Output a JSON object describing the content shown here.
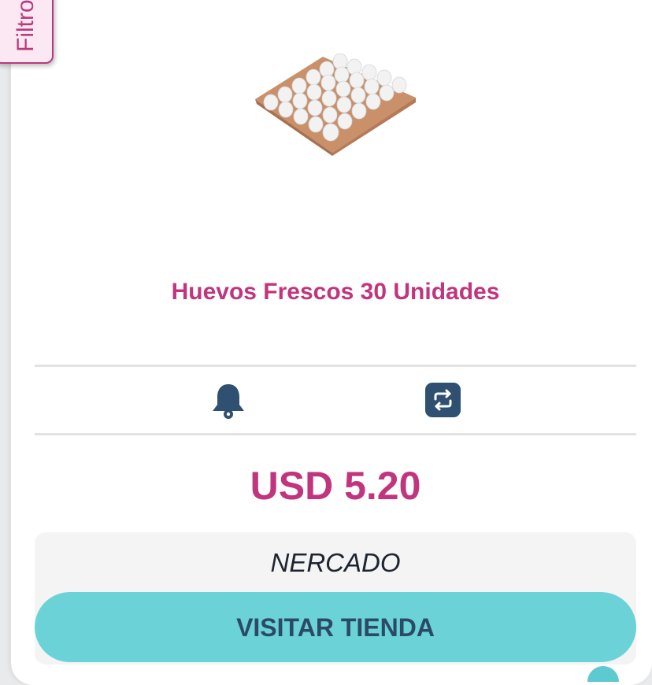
{
  "filter_tab": {
    "label": "Filtro"
  },
  "product": {
    "image": "egg-tray-image",
    "title": "Huevos Frescos 30 Unidades",
    "price": "USD 5.20"
  },
  "actions": {
    "alert_icon": "bell-icon",
    "compare_icon": "compare-arrows-icon"
  },
  "store": {
    "name": "NERCADO",
    "visit_label": "VISITAR TIENDA"
  },
  "colors": {
    "accent": "#c0357d",
    "button": "#6bd3d8",
    "button_text": "#2b4a66",
    "icon": "#2f5070"
  }
}
